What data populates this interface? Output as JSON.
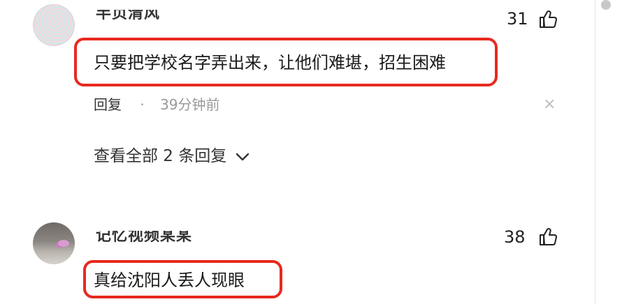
{
  "comments": [
    {
      "username": "半页清风",
      "likes": "31",
      "text": "只要把学校名字弄出来，让他们难堪，招生困难",
      "reply_label": "回复",
      "separator": "·",
      "time": "39分钟前",
      "close": "×",
      "view_replies": "查看全部 2 条回复"
    },
    {
      "username": "记忆视频某某",
      "likes": "38",
      "text": "真给沈阳人丢人现眼"
    }
  ],
  "colors": {
    "highlight_border": "#e8291f",
    "muted_text": "#999999"
  },
  "icons": [
    "thumbs-up-icon",
    "close-icon",
    "chevron-down-icon"
  ]
}
